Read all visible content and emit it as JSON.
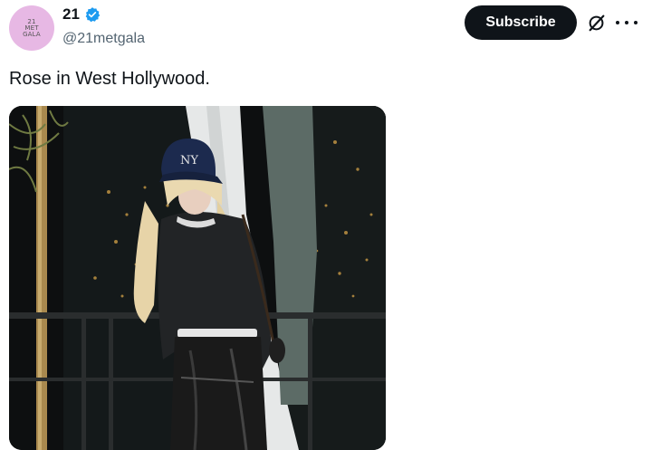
{
  "post": {
    "author": {
      "display_name": "21",
      "handle": "@21metgala",
      "verified": true,
      "avatar_text": [
        "21",
        "MET",
        "GALA"
      ],
      "avatar_color": "#e7b8e4"
    },
    "actions": {
      "subscribe_label": "Subscribe",
      "grok_icon": "grok-icon",
      "more_icon": "more-icon"
    },
    "text": "Rose in West Hollywood.",
    "media": {
      "type": "photo",
      "cap_logo": "NY"
    }
  },
  "colors": {
    "verified_blue": "#1d9bf0",
    "button_bg": "#0f1419",
    "secondary_text": "#536471"
  }
}
